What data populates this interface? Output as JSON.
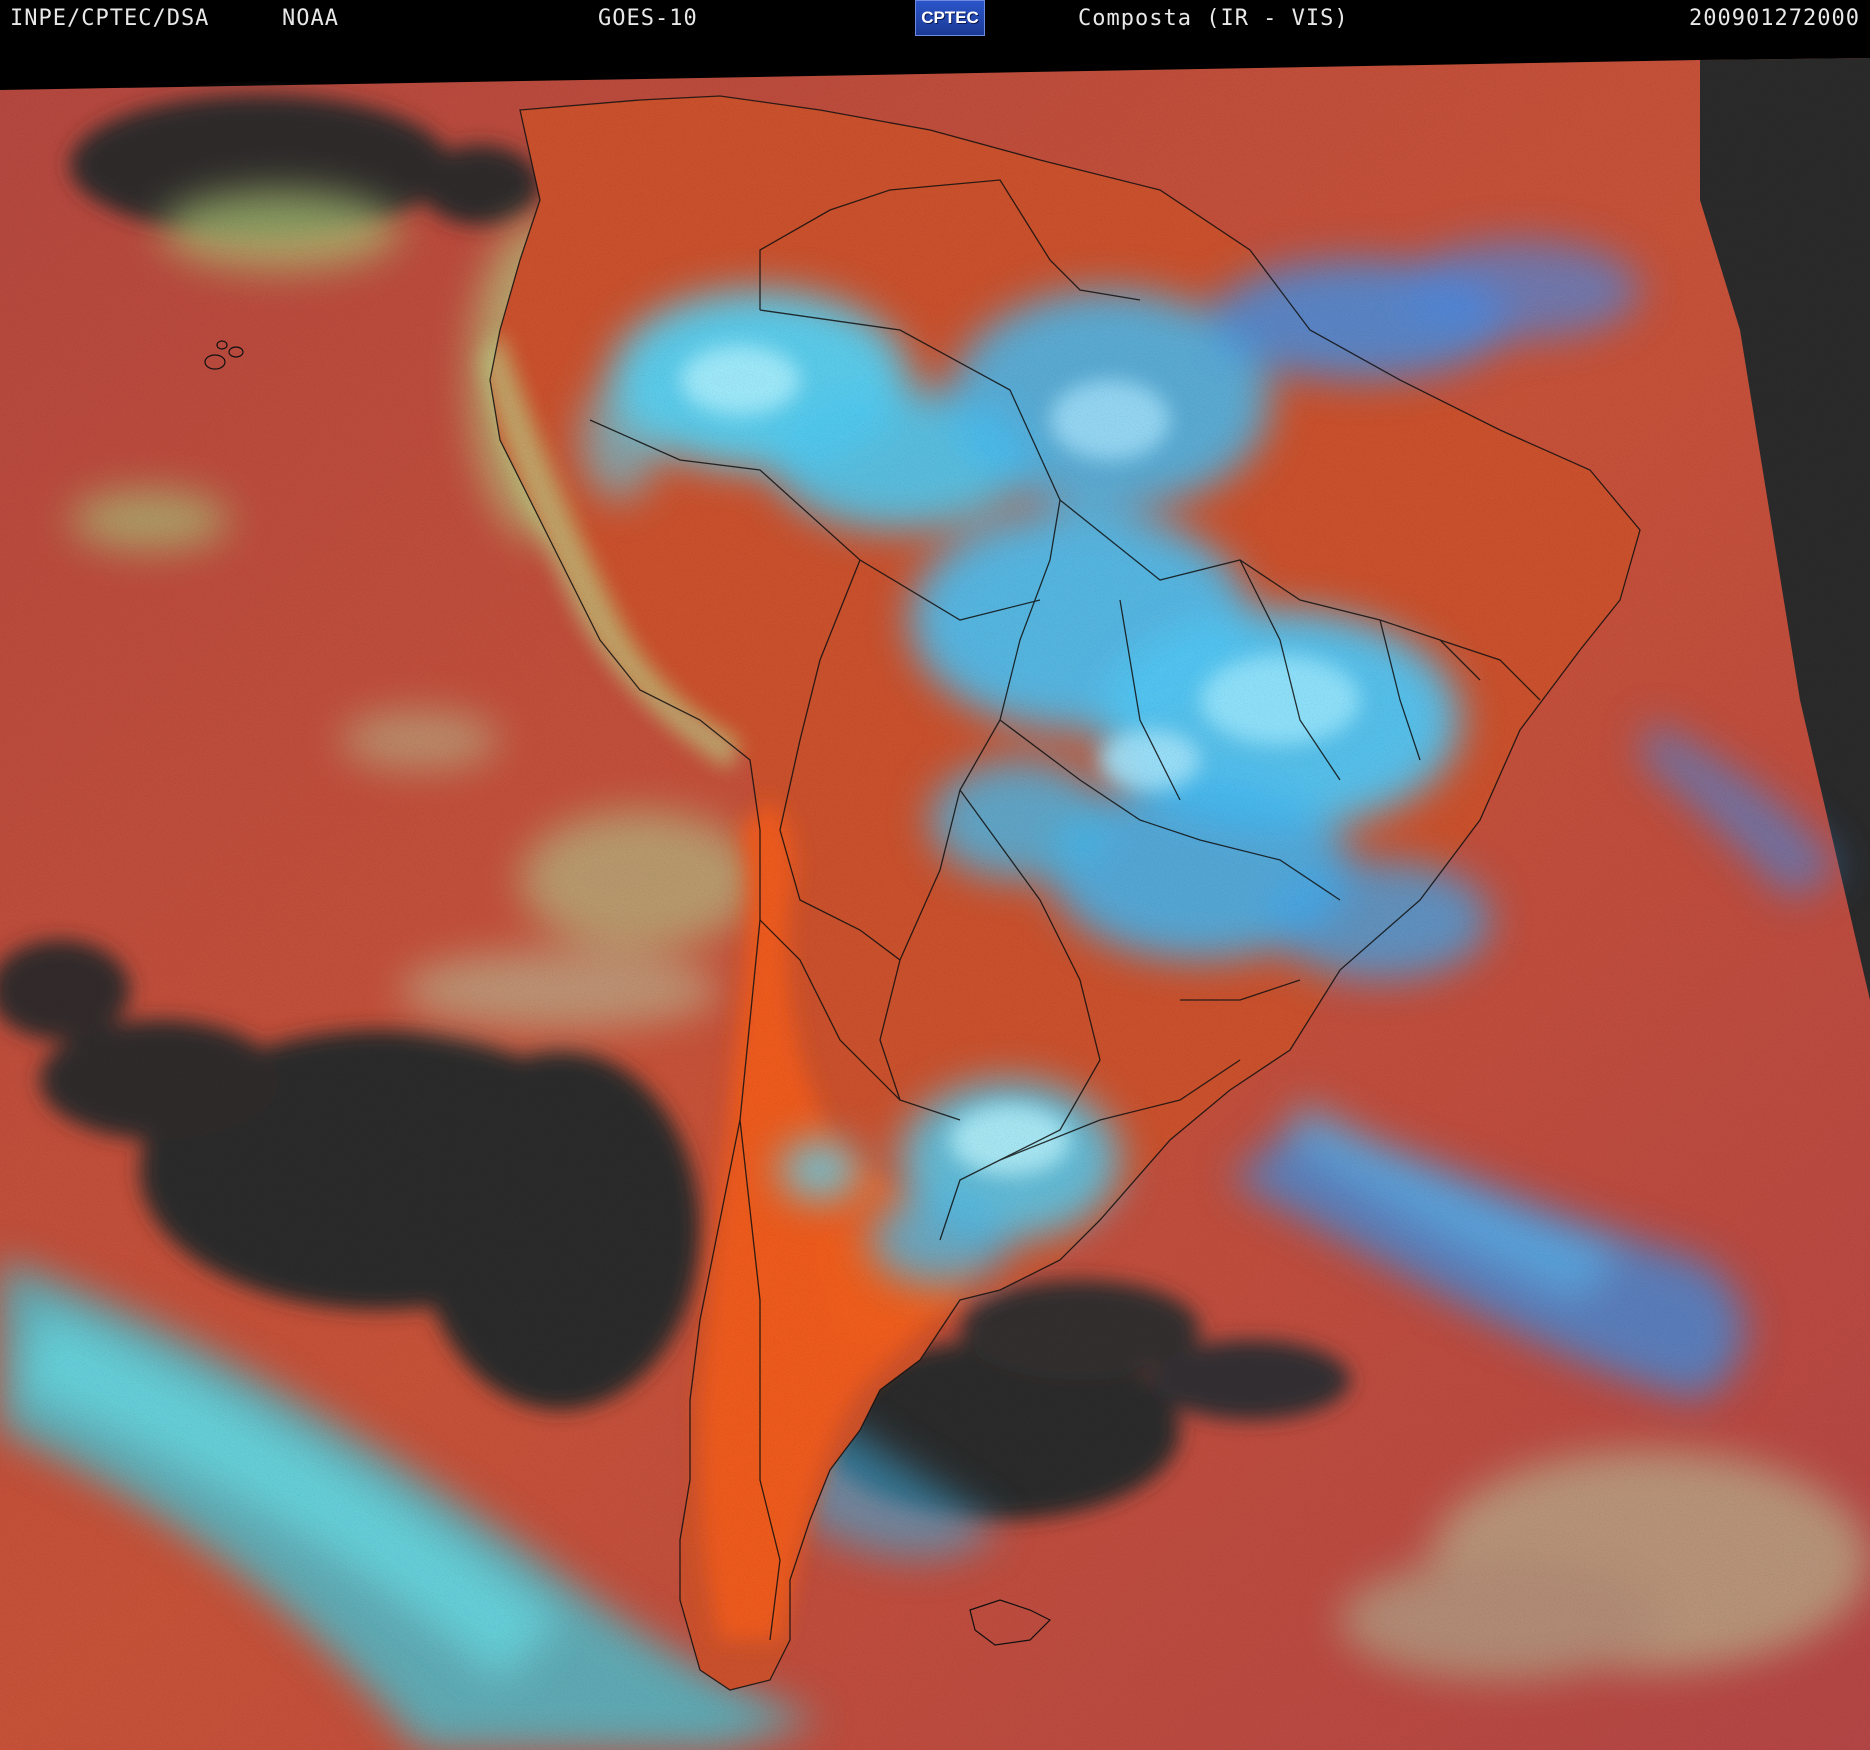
{
  "header": {
    "institution": "INPE/CPTEC/DSA",
    "agency": "NOAA",
    "satellite": "GOES-10",
    "logo_text": "CPTEC",
    "product": "Composta (IR - VIS)",
    "timestamp": "200901272000"
  },
  "colors": {
    "ocean_base": "#b84a3c",
    "land_orange": "#e8581f",
    "cloud_cyan": "#4fc8ee",
    "cloud_blue": "#3aa0f0",
    "clear_dark": "#2c2c2c",
    "haze_yellow": "#b9c774",
    "border_lines": "#111111"
  }
}
